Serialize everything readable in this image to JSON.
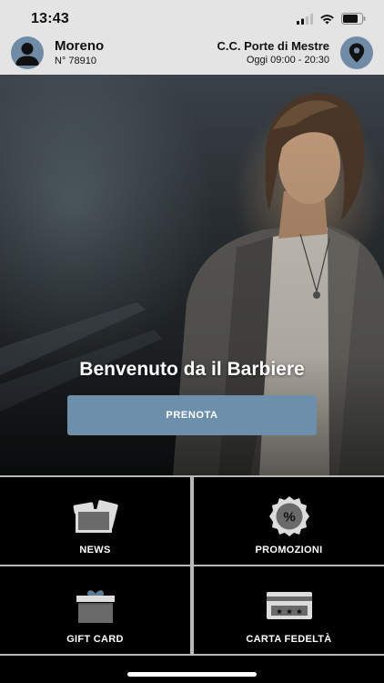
{
  "status_bar": {
    "time": "13:43"
  },
  "user": {
    "name": "Moreno",
    "number": "N° 78910"
  },
  "store": {
    "name": "C.C. Porte di Mestre",
    "hours": "Oggi 09:00 - 20:30"
  },
  "hero": {
    "title": "Benvenuto da il Barbiere",
    "book_label": "PRENOTA"
  },
  "tiles": [
    {
      "label": "NEWS",
      "icon": "news-icon"
    },
    {
      "label": "PROMOZIONI",
      "icon": "promotion-badge-icon"
    },
    {
      "label": "GIFT CARD",
      "icon": "gift-icon"
    },
    {
      "label": "CARTA FEDELTÀ",
      "icon": "loyalty-card-icon"
    }
  ],
  "colors": {
    "accent": "#6c8fab",
    "header_bg": "#e4e4e4",
    "tile_bg": "#000000"
  }
}
